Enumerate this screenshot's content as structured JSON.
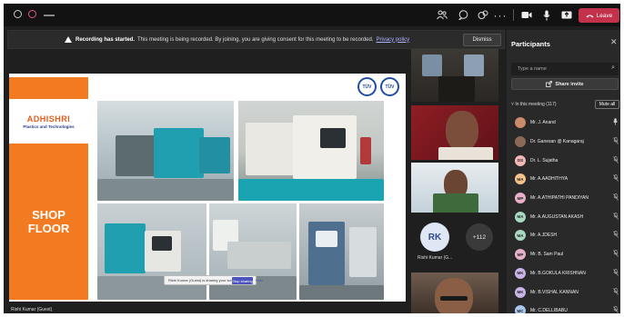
{
  "banner": {
    "bold": "Recording has started.",
    "message": "This meeting is being recorded. By joining, you are giving consent for this meeting to be recorded.",
    "link": "Privacy policy",
    "dismiss": "Dismiss"
  },
  "toolbar": {
    "leave_label": "Leave",
    "more_glyph": "···"
  },
  "slide": {
    "logo_name": "ADHISHRI",
    "logo_sub": "Plastics and Technologies",
    "shop_line1": "SHOP",
    "shop_line2": "FLOOR",
    "cert_label": "TÜV",
    "share_note": "Rishi Kumar (Guest) is sharing your screen",
    "stop_sharing": "Stop sharing",
    "hide": "Hide"
  },
  "presenter_name": "Rishi Kumar (Guest)",
  "tiles": {
    "rk_initials": "RK",
    "rk_name": "Rishi Kumar (G...",
    "more_count": "+112"
  },
  "panel": {
    "title": "Participants",
    "search_placeholder": "Type a name",
    "share_invite": "Share invite",
    "in_meeting": "In this meeting (117)",
    "mute_all": "Mute all",
    "participants": [
      {
        "initials": "",
        "name": "Mr. J. Anand",
        "color": "#c98b6a"
      },
      {
        "initials": "",
        "name": "Dr. Ganesan @ Kanagaraj",
        "color": "#8a6a55"
      },
      {
        "initials": "DS",
        "name": "Dr. L. Sujatha",
        "color": "#f2b7b7"
      },
      {
        "initials": "MA",
        "name": "Mr. A.AADHITHYA",
        "color": "#f5c28a"
      },
      {
        "initials": "MP",
        "name": "Mr. A.ATHIPATHI PANDIYAN",
        "color": "#e8b0c8"
      },
      {
        "initials": "MA",
        "name": "Mr. A.AUGUSTAN AKASH",
        "color": "#a8d8c0"
      },
      {
        "initials": "MA",
        "name": "Mr. A.JDESH",
        "color": "#a8d8c0"
      },
      {
        "initials": "MP",
        "name": "Mr. B. Sam Paul",
        "color": "#e8b0c8"
      },
      {
        "initials": "MK",
        "name": "Mr. B.GOKULA KRISHNAN",
        "color": "#c8b4e8"
      },
      {
        "initials": "MK",
        "name": "Mr. B.VISHAL KANNAN",
        "color": "#c8b4e8"
      },
      {
        "initials": "MC",
        "name": "Mr. C.DELLIBABU",
        "color": "#a8c8f0"
      }
    ]
  }
}
